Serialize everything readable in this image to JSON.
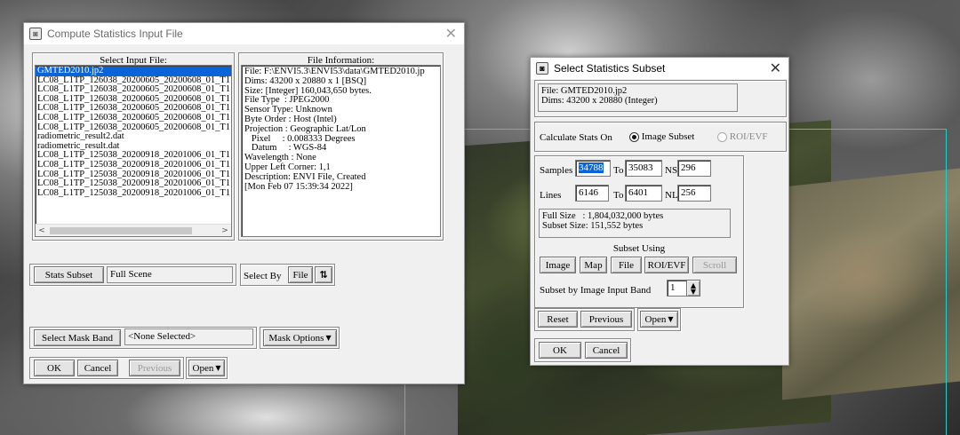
{
  "compute_window": {
    "title": "Compute Statistics Input File",
    "close_glyph": "✕",
    "select_input_header": "Select Input File:",
    "files": [
      "GMTED2010.jp2",
      "LC08_L1TP_126038_20200605_20200608_01_T1",
      "LC08_L1TP_126038_20200605_20200608_01_T1",
      "LC08_L1TP_126038_20200605_20200608_01_T1",
      "LC08_L1TP_126038_20200605_20200608_01_T1",
      "LC08_L1TP_126038_20200605_20200608_01_T1",
      "LC08_L1TP_126038_20200605_20200608_01_T1",
      "radiometric_result2.dat",
      "radiometric_result.dat",
      "LC08_L1TP_125038_20200918_20201006_01_T1",
      "LC08_L1TP_125038_20200918_20201006_01_T1",
      "LC08_L1TP_125038_20200918_20201006_01_T1",
      "LC08_L1TP_125038_20200918_20201006_01_T1",
      "LC08_L1TP_125038_20200918_20201006_01_T1"
    ],
    "file_info_header": "File Information:",
    "file_info": [
      "File: F:\\ENVI5.3\\ENVI53\\data\\GMTED2010.jp",
      "Dims: 43200 x 20880 x 1 [BSQ]",
      "Size: [Integer] 160,043,650 bytes.",
      "File Type  : JPEG2000",
      "Sensor Type: Unknown",
      "Byte Order : Host (Intel)",
      "Projection : Geographic Lat/Lon",
      "   Pixel     : 0.008333 Degrees",
      "   Datum     : WGS-84",
      "Wavelength : None",
      "Upper Left Corner: 1,1",
      "Description: ENVI File, Created",
      "[Mon Feb 07 15:39:34 2022]"
    ],
    "stats_subset_label": "Stats Subset",
    "stats_subset_value": "Full Scene",
    "select_by_label": "Select By",
    "select_by_value": "File",
    "sort_glyph": "⇅",
    "select_mask_band_label": "Select Mask Band",
    "mask_value": "<None Selected>",
    "mask_options_label": "Mask Options",
    "ok_label": "OK",
    "cancel_label": "Cancel",
    "previous_label": "Previous",
    "open_label": "Open"
  },
  "subset_window": {
    "title": "Select Statistics Subset",
    "close_glyph": "✕",
    "file_line": "File: GMTED2010.jp2",
    "dims_line": "Dims: 43200 x 20880 (Integer)",
    "calc_label": "Calculate Stats On",
    "option_image_subset": "Image Subset",
    "option_roi": "ROI/EVF",
    "samples_label": "Samples",
    "samples_from": "34788",
    "to_label": "To",
    "samples_to": "35083",
    "ns_label": "NS",
    "ns_value": "296",
    "lines_label": "Lines",
    "lines_from": "6146",
    "lines_to": "6401",
    "nl_label": "NL",
    "nl_value": "256",
    "full_size": "Full Size   : 1,804,032,000 bytes",
    "subset_size": "Subset Size: 151,552 bytes",
    "subset_using_label": "Subset Using",
    "btn_image": "Image",
    "btn_map": "Map",
    "btn_file": "File",
    "btn_roi": "ROI/EVF",
    "btn_scroll": "Scroll",
    "subset_by_band_label": "Subset by Image Input Band",
    "band_value": "1",
    "reset_label": "Reset",
    "previous_label": "Previous",
    "open_label": "Open",
    "ok_label": "OK",
    "cancel_label": "Cancel"
  }
}
